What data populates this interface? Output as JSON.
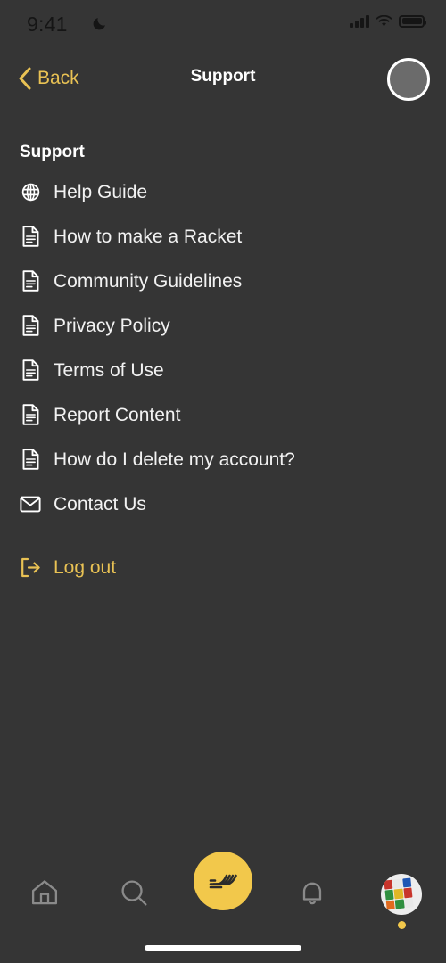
{
  "status_bar": {
    "time": "9:41",
    "dnd_icon": "crescent-moon-icon",
    "signal_icon": "cellular-signal-icon",
    "wifi_icon": "wifi-icon",
    "battery_icon": "battery-full-icon"
  },
  "nav": {
    "back_label": "Back",
    "back_icon": "chevron-left-icon",
    "title": "Support",
    "avatar_icon": "user-avatar-icon"
  },
  "section": {
    "header": "Support",
    "items": [
      {
        "label": "Help Guide",
        "icon": "globe-icon"
      },
      {
        "label": "How to make a Racket",
        "icon": "document-icon"
      },
      {
        "label": "Community Guidelines",
        "icon": "document-icon"
      },
      {
        "label": "Privacy Policy",
        "icon": "document-icon"
      },
      {
        "label": "Terms of Use",
        "icon": "document-icon"
      },
      {
        "label": "Report Content",
        "icon": "document-icon"
      },
      {
        "label": "How do I delete my account?",
        "icon": "document-icon"
      },
      {
        "label": "Contact Us",
        "icon": "envelope-icon"
      }
    ]
  },
  "logout": {
    "label": "Log out",
    "icon": "sign-out-icon"
  },
  "tab_bar": {
    "items": [
      {
        "name": "home",
        "icon": "home-icon"
      },
      {
        "name": "search",
        "icon": "search-icon"
      },
      {
        "name": "create",
        "icon": "racket-strings-logo-icon"
      },
      {
        "name": "notifications",
        "icon": "bell-icon"
      },
      {
        "name": "profile",
        "icon": "profile-avatar-icon"
      }
    ],
    "active": "profile"
  },
  "colors": {
    "background": "#353535",
    "accent": "#E9C254",
    "fab": "#F2C84B",
    "text_primary": "#f2f2f2",
    "tab_inactive": "#8a8a8a"
  }
}
